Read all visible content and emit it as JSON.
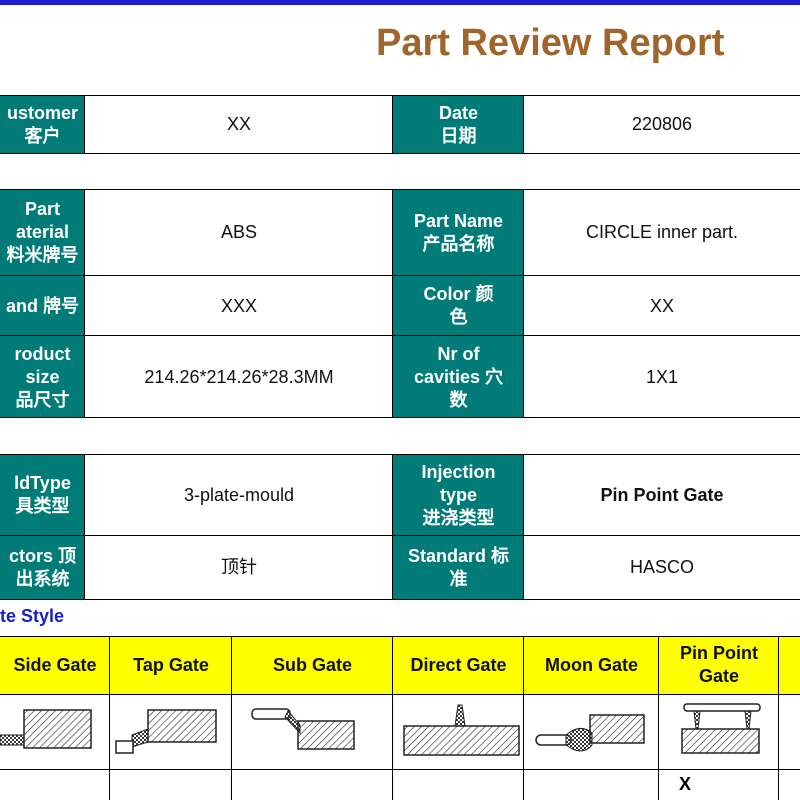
{
  "header": {
    "title": "Part Review Report"
  },
  "info_table_1": {
    "customer_label": "ustomer\n客户",
    "customer_value": "XX",
    "date_label": "Date\n日期",
    "date_value": "220806"
  },
  "info_table_2": {
    "material_label": "Part\naterial\n料米牌号",
    "material_value": "ABS",
    "part_name_label": "Part Name\n产品名称",
    "part_name_value": "CIRCLE  inner part.",
    "brand_label": "and 牌号",
    "brand_value": "XXX",
    "color_label": "Color    颜\n色",
    "color_value": "XX",
    "size_label": "roduct\nsize\n品尺寸",
    "size_value": "214.26*214.26*28.3MM",
    "cavities_label": "Nr of\ncavities 穴\n数",
    "cavities_value": "1X1"
  },
  "info_table_3": {
    "mold_type_label": "ldType\n具类型",
    "mold_type_value": "3-plate-mould",
    "injection_label": "Injection\ntype\n进浇类型",
    "injection_value": "Pin Point Gate",
    "ejectors_label": "ctors 顶\n出系统",
    "ejectors_value": "顶针",
    "standard_label": "Standard 标\n准",
    "standard_value": "HASCO"
  },
  "gate_section": {
    "title": "te Style",
    "headers": [
      "Side Gate",
      "Tap Gate",
      "Sub Gate",
      "Direct Gate",
      "Moon Gate",
      "Pin Point\nGate"
    ],
    "selected_mark": "X"
  }
}
